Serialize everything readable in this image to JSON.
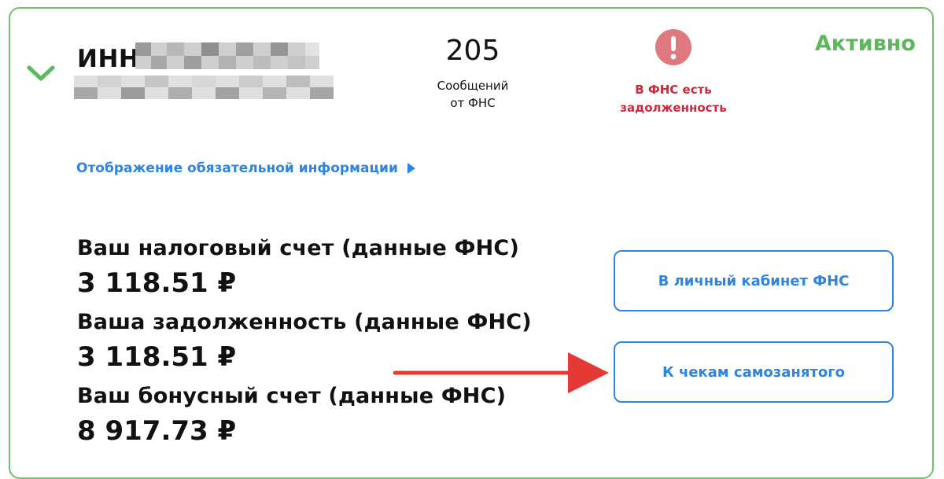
{
  "header": {
    "inn_label": "ИНН",
    "messages_count": "205",
    "messages_label_line1": "Сообщений",
    "messages_label_line2": "от ФНС",
    "debt_alert_line1": "В ФНС есть",
    "debt_alert_line2": "задолженность",
    "status": "Активно"
  },
  "links": {
    "mandatory_info": "Отображение обязательной информации"
  },
  "accounts": [
    {
      "label": "Ваш налоговый счет (данные ФНС)",
      "amount": "3 118.51 ₽"
    },
    {
      "label": "Ваша задолженность (данные ФНС)",
      "amount": "3 118.51 ₽"
    },
    {
      "label": "Ваш бонусный счет (данные ФНС)",
      "amount": "8 917.73 ₽"
    }
  ],
  "buttons": {
    "fns_cabinet": "В личный кабинет ФНС",
    "self_employed_receipts": "К чекам самозанятого"
  },
  "colors": {
    "accent_green": "#5cb85c",
    "link_blue": "#2e84de",
    "alert_red": "#c9293b",
    "alert_icon": "#e0787f",
    "arrow_red": "#e53935"
  },
  "icons": [
    "chevron-down-icon",
    "exclamation-circle-icon",
    "triangle-right-icon",
    "annotation-arrow"
  ]
}
